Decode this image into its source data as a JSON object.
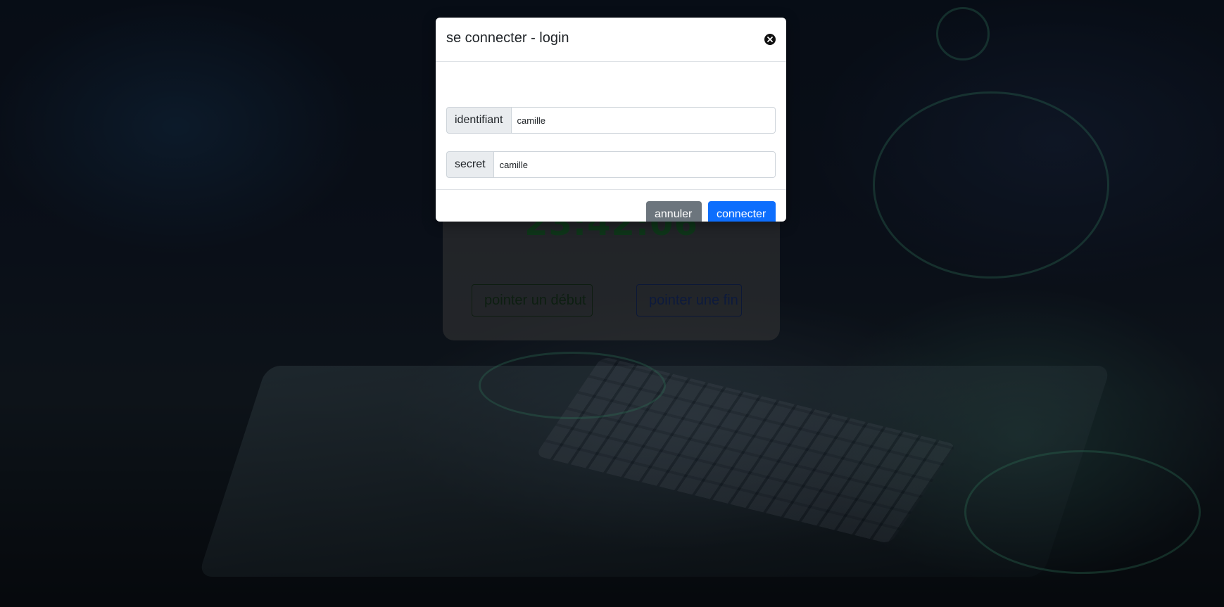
{
  "background": {
    "overlay_color": "#000000"
  },
  "card": {
    "clock": "23:42:06",
    "start_button_label": "pointer un début",
    "end_button_label": "pointer une fin",
    "clock_color": "#1d6b32"
  },
  "modal": {
    "title": "se connecter - login",
    "close_icon": "close-icon",
    "fields": [
      {
        "label": "identifiant",
        "value": "camille"
      },
      {
        "label": "secret",
        "value": "camille"
      }
    ],
    "cancel_label": "annuler",
    "connect_label": "connecter",
    "cancel_color": "#6c757d",
    "connect_color": "#0d6efd"
  }
}
